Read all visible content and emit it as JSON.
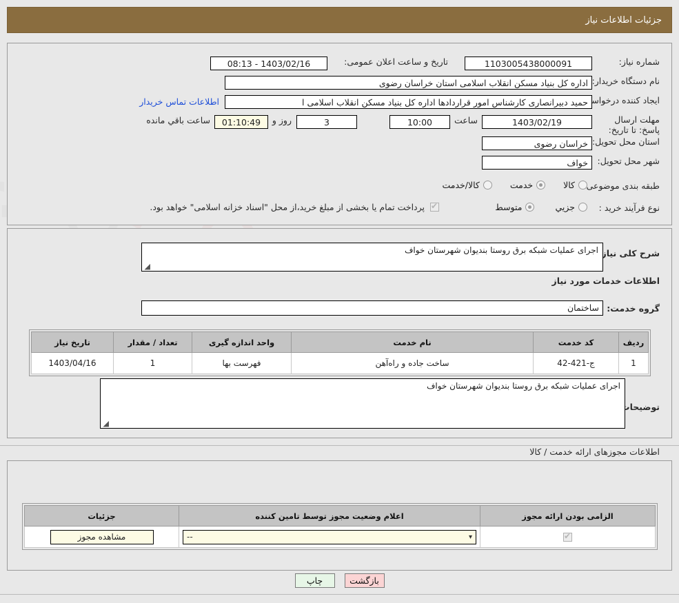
{
  "header": {
    "title": "جزئیات اطلاعات نیاز"
  },
  "form": {
    "need_number_label": "شماره نیاز:",
    "need_number_value": "1103005438000091",
    "announce_label": "تاریخ و ساعت اعلان عمومی:",
    "announce_value": "1403/02/16 - 08:13",
    "buyer_org_label": "نام دستگاه خریدار:",
    "buyer_org_value": "اداره کل بنیاد مسکن انقلاب اسلامی استان خراسان رضوی",
    "creator_label": "ایجاد کننده درخواست:",
    "creator_value": "حمید دبیرانصاری کارشناس امور قراردادها اداره کل بنیاد مسکن انقلاب اسلامی ا",
    "contact_link": "اطلاعات تماس خریدار",
    "deadline_label": "مهلت ارسال پاسخ: تا تاریخ:",
    "deadline_date": "1403/02/19",
    "hour_label": "ساعت",
    "deadline_time": "10:00",
    "days_value": "3",
    "days_label": "روز و",
    "countdown_value": "01:10:49",
    "remaining_label": "ساعت باقي مانده",
    "province_label": "استان محل تحویل:",
    "province_value": "خراسان رضوی",
    "city_label": "شهر محل تحویل:",
    "city_value": "خواف",
    "category_label": "طبقه بندی موضوعی:",
    "category_options": [
      {
        "label": "کالا",
        "selected": false
      },
      {
        "label": "خدمت",
        "selected": true
      },
      {
        "label": "کالا/خدمت",
        "selected": false
      }
    ],
    "process_label": "نوع فرآیند خرید :",
    "process_options": [
      {
        "label": "جزیي",
        "selected": false
      },
      {
        "label": "متوسط",
        "selected": true
      }
    ],
    "treasury_checked": true,
    "treasury_note": "پرداخت تمام یا بخشی از مبلغ خرید،از محل \"اسناد خزانه اسلامی\" خواهد بود."
  },
  "need_desc": {
    "label": "شرح کلی نیاز:",
    "value": "اجرای عملیات شبکه برق روستا بندیوان شهرستان خواف"
  },
  "service_section": {
    "heading": "اطلاعات خدمات مورد نیاز",
    "group_label": "گروه خدمت:",
    "group_value": "ساختمان"
  },
  "service_table": {
    "columns": [
      "ردیف",
      "کد خدمت",
      "نام خدمت",
      "واحد اندازه گیری",
      "تعداد / مقدار",
      "تاریخ نیاز"
    ],
    "rows": [
      [
        "1",
        "ج-421-42",
        "ساخت جاده و راه‌آهن",
        "فهرست بها",
        "1",
        "1403/04/16"
      ]
    ]
  },
  "buyer_notes": {
    "label": "توضیحات خریدار:",
    "value": "اجرای عملیات شبکه برق روستا بندیوان شهرستان خواف"
  },
  "permits": {
    "heading": "اطلاعات مجوزهای ارائه خدمت / کالا",
    "columns": [
      "الزامی بودن ارائه مجوز",
      "اعلام وضعیت مجوز توسط تامین کننده",
      "جزئیات"
    ],
    "row": {
      "required_checked": true,
      "status_value": "--",
      "details_button": "مشاهده مجوز"
    }
  },
  "footer": {
    "print_label": "چاپ",
    "back_label": "بازگشت"
  },
  "colors": {
    "header_bar": "#8a6d3f",
    "link": "#1f4fd8",
    "grid_header": "#c4c4c4",
    "cream": "#fdfbe4",
    "print_btn": "#e7f6e7",
    "back_btn": "#fbd4d4"
  }
}
